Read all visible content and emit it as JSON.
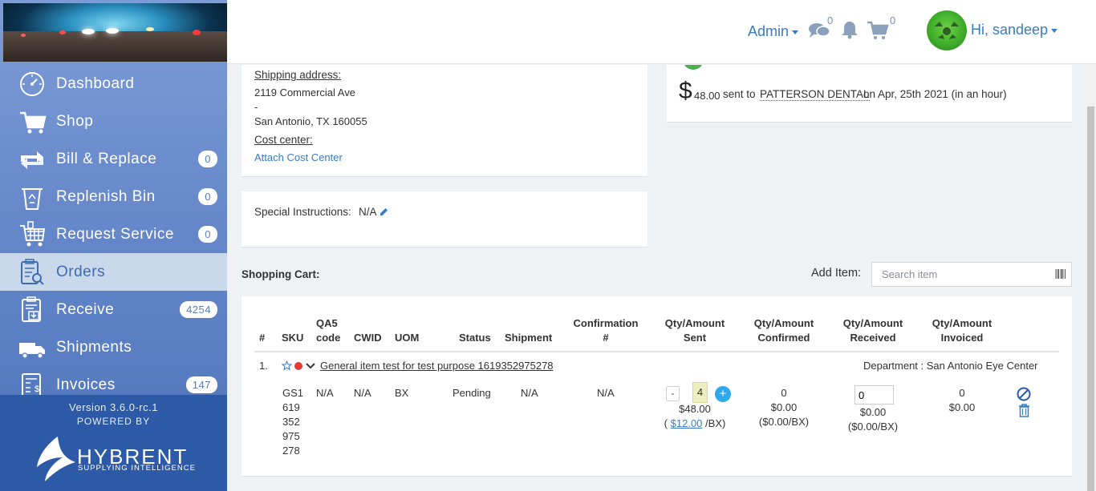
{
  "sidebar": {
    "items": [
      {
        "label": "Dashboard",
        "badge": "",
        "icon": "dashboard-icon"
      },
      {
        "label": "Shop",
        "badge": "",
        "icon": "cart-icon"
      },
      {
        "label": "Bill & Replace",
        "badge": "0",
        "icon": "bill-replace-icon"
      },
      {
        "label": "Replenish Bin",
        "badge": "0",
        "icon": "recycle-bin-icon"
      },
      {
        "label": "Request Service",
        "badge": "0",
        "icon": "service-cart-icon"
      },
      {
        "label": "Orders",
        "badge": "",
        "icon": "orders-icon"
      },
      {
        "label": "Receive",
        "badge": "4254",
        "icon": "receive-icon"
      },
      {
        "label": "Shipments",
        "badge": "",
        "icon": "truck-icon"
      },
      {
        "label": "Invoices",
        "badge": "147",
        "icon": "invoice-icon"
      }
    ],
    "version": "Version 3.6.0-rc.1",
    "powered_by": "POWERED BY",
    "brand": "HYBRENT",
    "tagline": "SUPPLYING INTELLIGENCE"
  },
  "header": {
    "admin": "Admin",
    "messages_count": "0",
    "cart_count": "0",
    "greeting": "Hi, sandeep"
  },
  "shipping": {
    "label": "Shipping address:",
    "line1": "2119 Commercial Ave",
    "line2": "-",
    "line3": "San Antonio, TX 160055",
    "cost_center_label": "Cost center:",
    "cost_center_link": "Attach Cost Center"
  },
  "special": {
    "label": "Special Instructions:",
    "value": "N/A"
  },
  "payment": {
    "currency": "$",
    "amount": "48.00",
    "sent_to": "sent to",
    "vendor": "PATTERSON DENTAL",
    "date_text": "on Apr, 25th 2021 (in an hour)"
  },
  "cart": {
    "title": "Shopping Cart:",
    "add_item_label": "Add Item:",
    "search_placeholder": "Search item",
    "headers": {
      "num": "#",
      "sku": "SKU",
      "qa5_1": "QA5",
      "qa5_2": "code",
      "cwid": "CWID",
      "uom": "UOM",
      "status": "Status",
      "shipment": "Shipment",
      "conf_1": "Confirmation",
      "conf_2": "#",
      "sent_1": "Qty/Amount",
      "sent_2": "Sent",
      "confirmed_1": "Qty/Amount",
      "confirmed_2": "Confirmed",
      "received_1": "Qty/Amount",
      "received_2": "Received",
      "invoiced_1": "Qty/Amount",
      "invoiced_2": "Invoiced"
    },
    "row": {
      "num": "1.",
      "name": "General item test for test purpose 1619352975278",
      "department": "Department : San Antonio Eye Center",
      "sku_lines": [
        "GS1",
        "619",
        "352",
        "975",
        "278"
      ],
      "qa5": "N/A",
      "cwid": "N/A",
      "uom": "BX",
      "status": "Pending",
      "shipment": "N/A",
      "confirmation": "N/A",
      "qty": "4",
      "minus": "-",
      "plus": "+",
      "sent_amount": "$48.00",
      "unit_open": "(",
      "unit_price": "$12.00",
      "unit_suffix": "/BX)",
      "confirmed_qty": "0",
      "confirmed_amount": "$0.00",
      "confirmed_unit": "($0.00/BX)",
      "received_qty": "0",
      "received_amount": "$0.00",
      "received_unit": "($0.00/BX)",
      "invoiced_qty": "0",
      "invoiced_amount": "$0.00"
    }
  }
}
